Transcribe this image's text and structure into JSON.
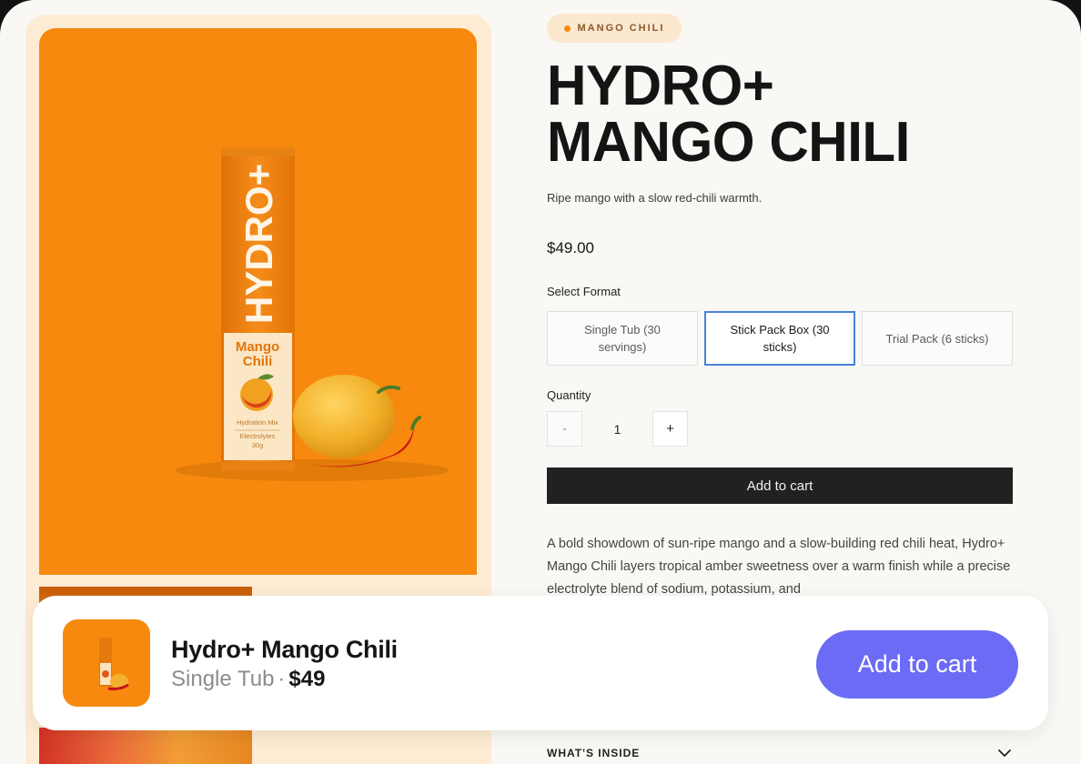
{
  "product": {
    "badge": "MANGO CHILI",
    "title_line1": "HYDRO+",
    "title_line2": "MANGO CHILI",
    "subtitle": "Ripe mango with a slow red-chili warmth.",
    "price": "$49.00",
    "pack_brand": "HYDRO+",
    "pack_flavor_line1": "Mango",
    "pack_flavor_line2": "Chili",
    "pack_caption1": "Hydration Mix",
    "pack_caption2": "Electrolytes",
    "pack_caption3": "30g"
  },
  "format": {
    "label": "Select Format",
    "options": [
      "Single Tub (30 servings)",
      "Stick Pack Box (30 sticks)",
      "Trial Pack (6 sticks)"
    ],
    "selected": "Stick Pack Box (30 sticks)"
  },
  "quantity": {
    "label": "Quantity",
    "minus": "-",
    "value": "1",
    "plus": "+"
  },
  "actions": {
    "add_to_cart": "Add to cart"
  },
  "description": "A bold showdown of sun-ripe mango and a slow-building red chili heat, Hydro+ Mango Chili layers tropical amber sweetness over a warm finish while a precise electrolyte blend of sodium, potassium, and",
  "accordion": {
    "whats_inside": "WHAT'S INSIDE"
  },
  "sticky_bar": {
    "name": "Hydro+ Mango Chili",
    "format": "Single Tub",
    "separator": "·",
    "price": "$49",
    "cta": "Add to cart"
  },
  "colors": {
    "brand_orange": "#f7890e",
    "cta_purple": "#6b6bf5",
    "selected_border": "#4a82d6",
    "dark_button": "#212121"
  },
  "icons": {
    "accordion": "chevron-down-icon",
    "badge": "dot-icon"
  }
}
